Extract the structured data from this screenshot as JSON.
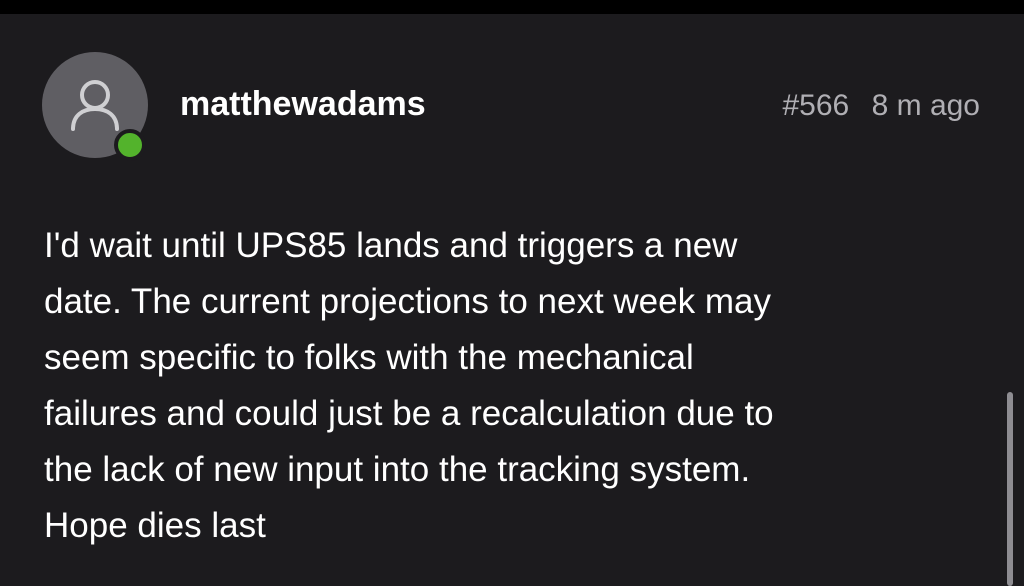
{
  "post": {
    "username": "matthewadams",
    "post_number": "#566",
    "time_ago": "8 m ago",
    "avatar_icon": "user-silhouette-icon",
    "online_status_color": "#53b32c",
    "body_lines": [
      "I'd wait until UPS85 lands and triggers a new",
      "date. The current projections to next week may",
      "seem specific to folks with the mechanical",
      "failures and could just be a recalculation due to",
      "the lack of new input into the tracking system.",
      "Hope dies last"
    ]
  },
  "colors": {
    "background": "#1c1b1e",
    "text": "#ffffff",
    "muted_text": "#b0afb4",
    "avatar_bg": "#5f5e63"
  }
}
